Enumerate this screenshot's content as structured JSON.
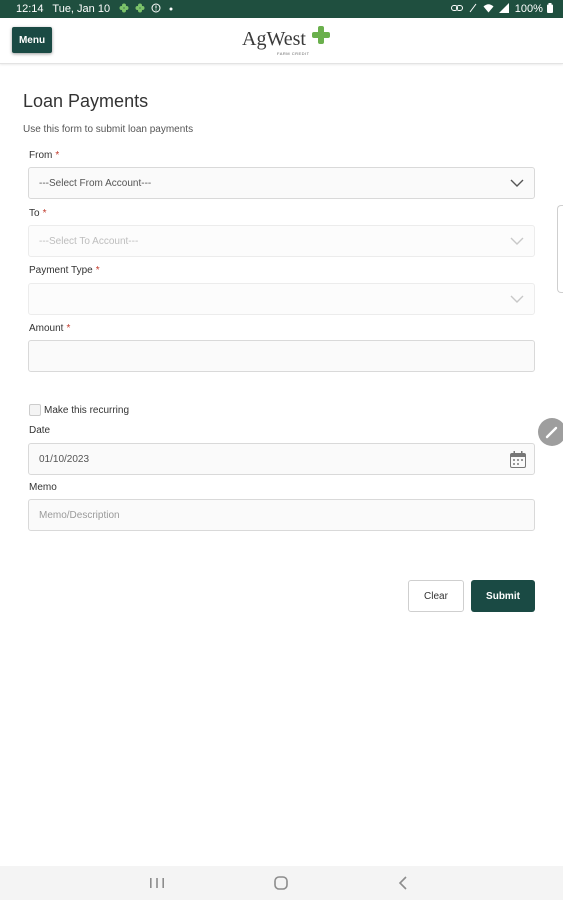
{
  "status_bar": {
    "time": "12:14",
    "date": "Tue, Jan 10",
    "battery": "100%",
    "left_icons": [
      "clover-icon",
      "clover-icon",
      "alert-icon",
      "dot-icon"
    ],
    "right_icons": [
      "link-icon",
      "mute-icon",
      "wifi-icon",
      "signal-icon",
      "battery-icon"
    ]
  },
  "header": {
    "menu_label": "Menu",
    "logo_text": "AgWest",
    "logo_subtext": "FARM CREDIT"
  },
  "page": {
    "title": "Loan Payments",
    "subtitle": "Use this form to submit loan payments"
  },
  "form": {
    "from": {
      "label": "From",
      "required_mark": "*",
      "value": "---Select From Account---"
    },
    "to": {
      "label": "To",
      "required_mark": "*",
      "value": "---Select To Account---"
    },
    "payment_type": {
      "label": "Payment Type",
      "required_mark": "*",
      "value": ""
    },
    "amount": {
      "label": "Amount",
      "required_mark": "*",
      "value": ""
    },
    "recurring": {
      "label": "Make this recurring",
      "checked": false
    },
    "date": {
      "label": "Date",
      "value": "01/10/2023"
    },
    "memo": {
      "label": "Memo",
      "placeholder": "Memo/Description",
      "value": ""
    }
  },
  "buttons": {
    "clear": "Clear",
    "submit": "Submit"
  },
  "colors": {
    "status_bar": "#1f4f3f",
    "primary": "#1a4a44",
    "required": "#c0392b",
    "logo_green": "#6ab04c"
  }
}
